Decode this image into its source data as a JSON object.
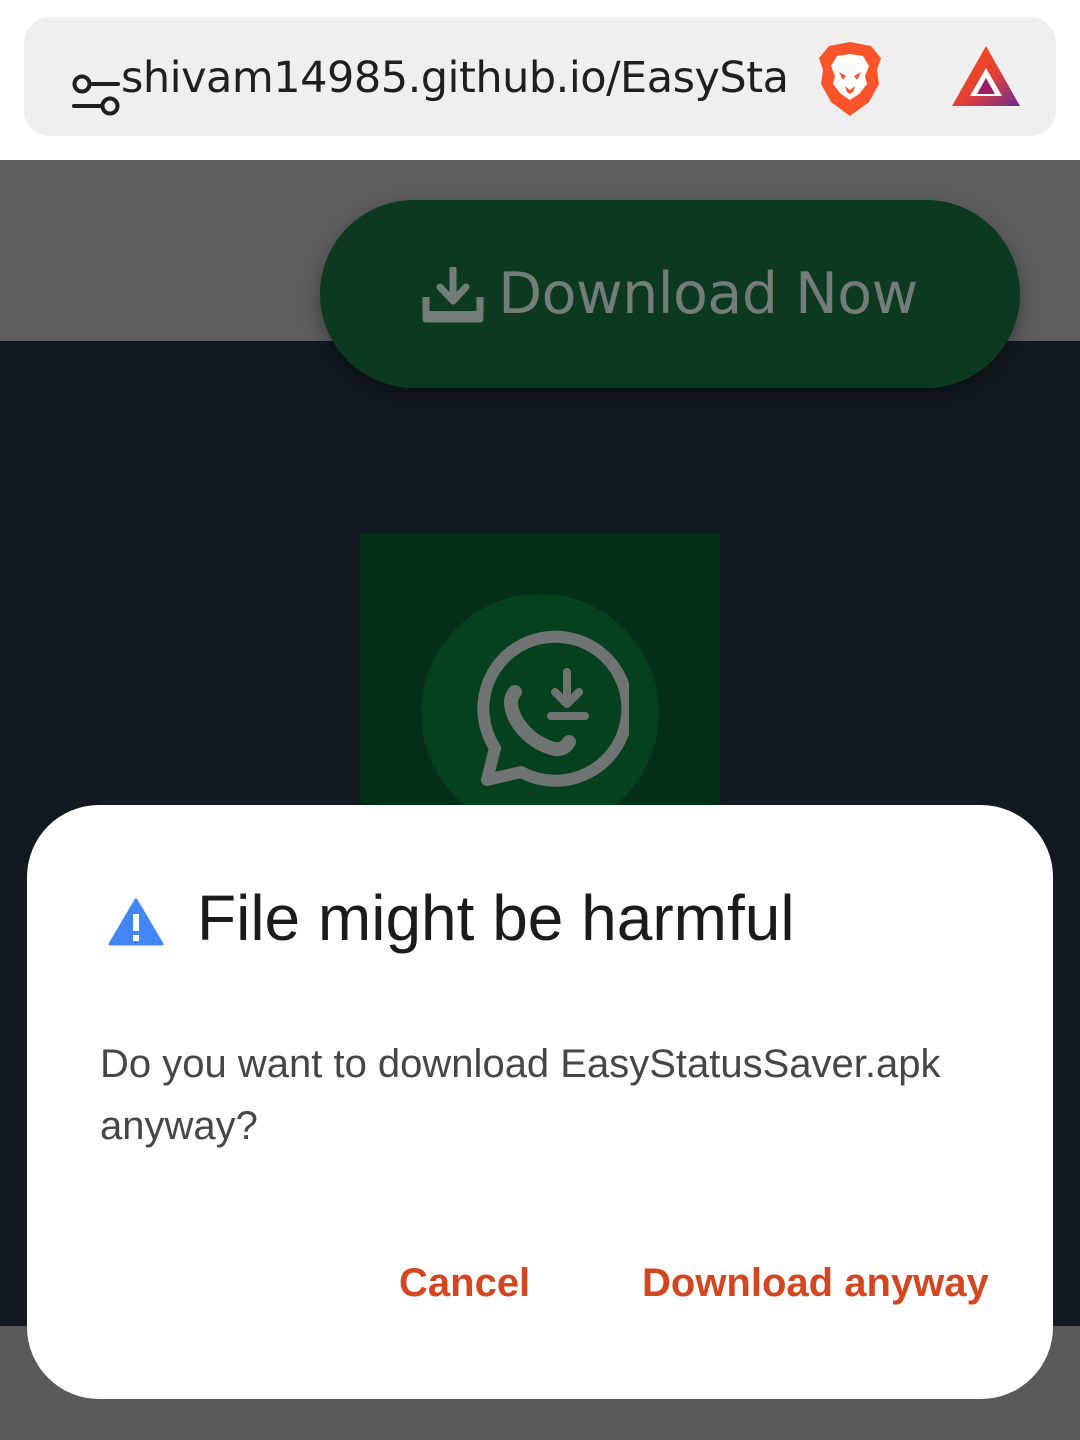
{
  "browser": {
    "url": "shivam14985.github.io/EasySta",
    "icons": {
      "site_settings": "tune-icon",
      "shield": "brave-shield-icon",
      "rewards": "bat-rewards-icon"
    },
    "colors": {
      "shield": "#fb542b",
      "rewards_a": "#e3403a",
      "rewards_b": "#662d91"
    }
  },
  "page": {
    "download_button_label": "Download Now",
    "colors": {
      "header_overlay": "#5d5d5d",
      "body": "#121920",
      "button": "#0b3a20"
    }
  },
  "dialog": {
    "icon": "warning-icon",
    "title": "File might be harmful",
    "message": "Do you want to download EasyStatusSaver.apk anyway?",
    "cancel_label": "Cancel",
    "confirm_label": "Download anyway",
    "colors": {
      "warning": "#4285f4",
      "action": "#d4461f"
    }
  }
}
